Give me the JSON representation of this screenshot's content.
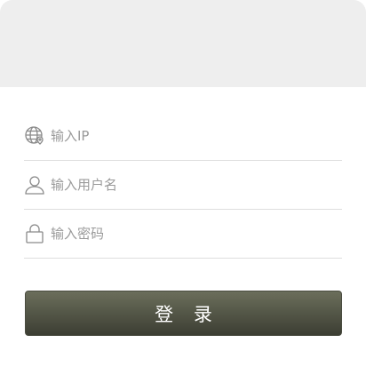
{
  "form": {
    "fields": [
      {
        "icon": "globe-location-icon",
        "placeholder": "输入IP",
        "value": ""
      },
      {
        "icon": "user-icon",
        "placeholder": "输入用户名",
        "value": ""
      },
      {
        "icon": "lock-icon",
        "placeholder": "输入密码",
        "value": ""
      }
    ]
  },
  "login_button": {
    "label": "登 录"
  },
  "colors": {
    "header_band": "#eeeeee",
    "button_top": "#6b6e5b",
    "button_bottom": "#3c3e33",
    "divider": "#dedede",
    "icon": "#8a8a8a"
  }
}
